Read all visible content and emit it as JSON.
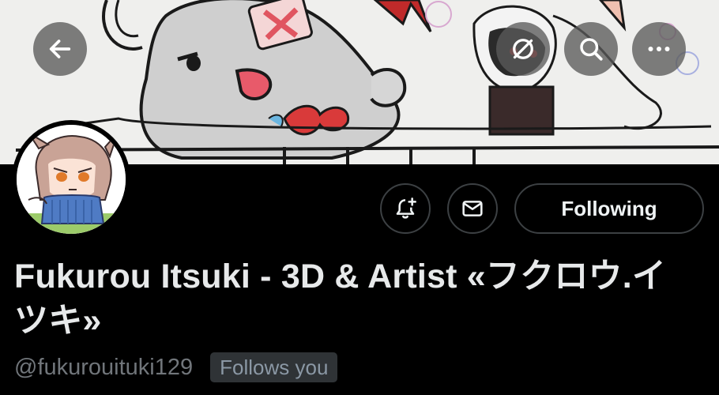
{
  "banner": {
    "description_icon": "banner-illustration"
  },
  "header_controls": {
    "back_icon": "arrow-left-icon",
    "unmute_icon": "circle-slash-icon",
    "search_icon": "search-icon",
    "more_icon": "more-horizontal-icon"
  },
  "profile": {
    "display_name": "Fukurou Itsuki - 3D & Artist «フクロウ.イツキ»",
    "handle": "@fukurouituki129",
    "follows_you": "Follows you"
  },
  "actions": {
    "notify_icon": "bell-plus-icon",
    "message_icon": "envelope-icon",
    "following_label": "Following"
  }
}
